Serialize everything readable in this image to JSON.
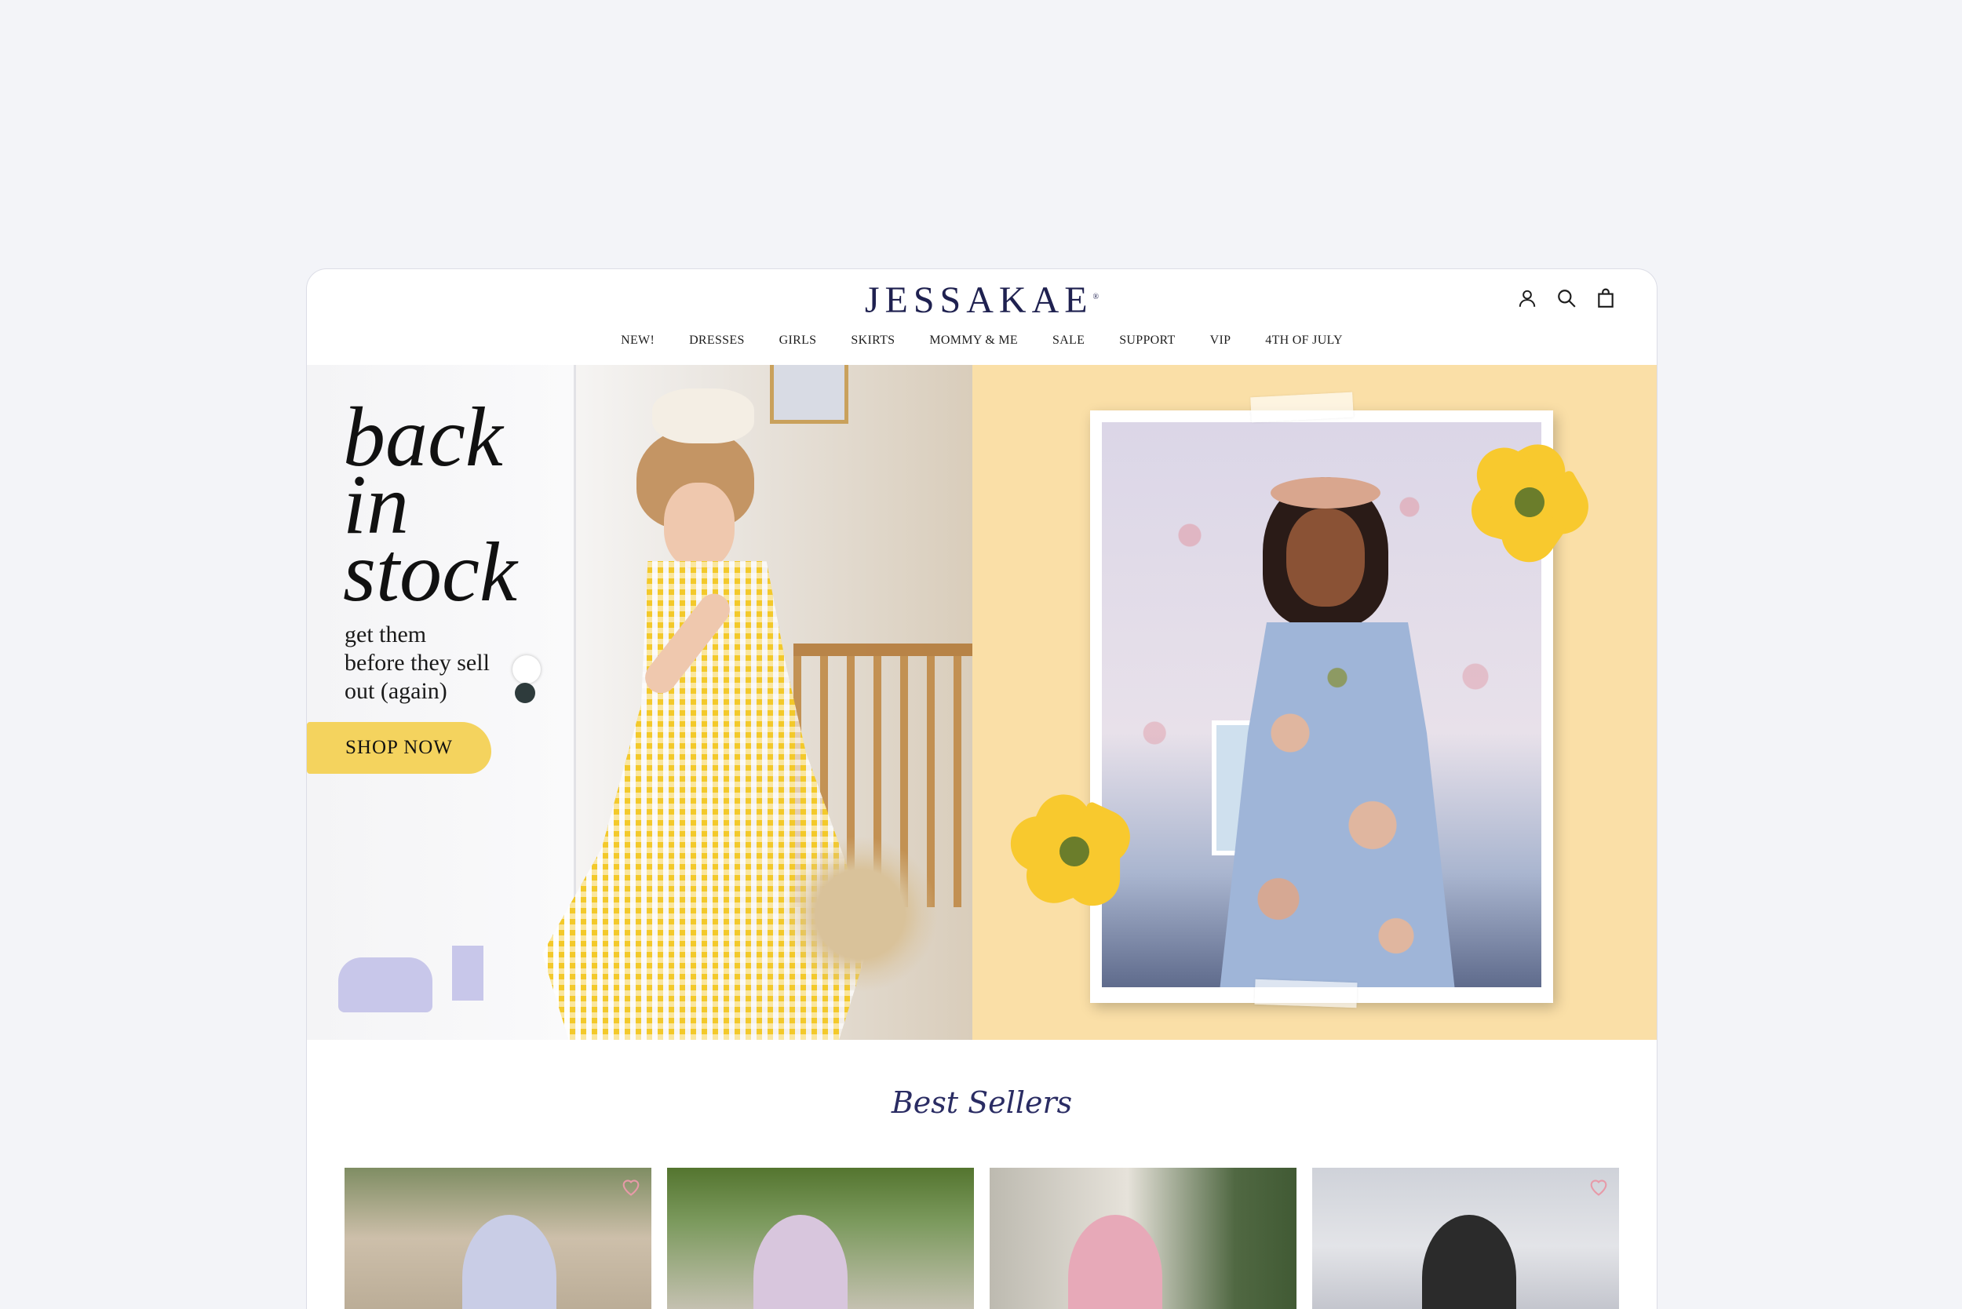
{
  "brand": {
    "name": "JESSAKAE",
    "mark": "®"
  },
  "header": {
    "icons": [
      "account-icon",
      "search-icon",
      "cart-icon"
    ]
  },
  "nav": {
    "items": [
      {
        "label": "NEW!"
      },
      {
        "label": "DRESSES"
      },
      {
        "label": "GIRLS"
      },
      {
        "label": "SKIRTS"
      },
      {
        "label": "MOMMY & ME"
      },
      {
        "label": "SALE"
      },
      {
        "label": "SUPPORT"
      },
      {
        "label": "VIP"
      },
      {
        "label": "4TH OF JULY"
      }
    ]
  },
  "hero": {
    "title_lines": [
      "back",
      "in",
      "stock"
    ],
    "subtitle_lines": [
      "get them",
      "before they sell",
      "out (again)"
    ],
    "cta": "SHOP NOW"
  },
  "best_sellers": {
    "title": "Best Sellers",
    "products": [
      {
        "wishlist_icon": "heart-icon"
      },
      {},
      {},
      {
        "wishlist_icon": "heart-icon"
      }
    ]
  },
  "colors": {
    "brand_navy": "#1f2150",
    "hero_right_bg": "#fadfa7",
    "cta_yellow": "#f4d35e",
    "page_bg": "#f3f4f8"
  }
}
